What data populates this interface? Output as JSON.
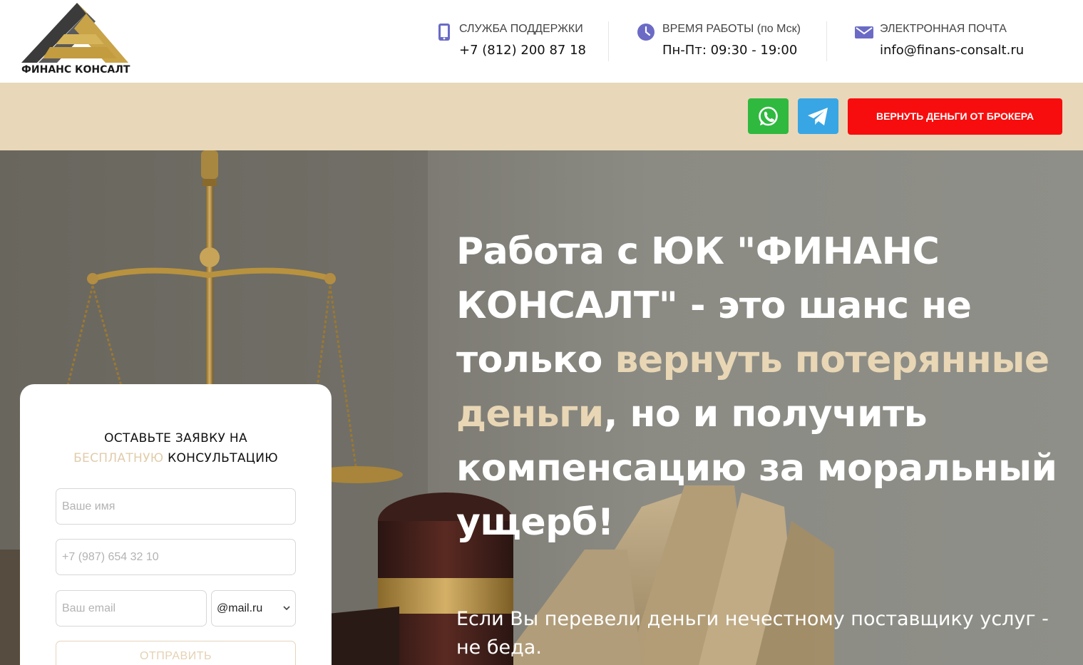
{
  "brand": {
    "logo_text": "ФИНАНС КОНСАЛТ"
  },
  "contacts": [
    {
      "label": "СЛУЖБА ПОДДЕРЖКИ",
      "value": "+7 (812) 200 87 18",
      "icon": "phone-icon"
    },
    {
      "label": "ВРЕМЯ РАБОТЫ (по Мск)",
      "value": "Пн-Пт: 09:30 - 19:00",
      "icon": "clock-icon"
    },
    {
      "label": "ЭЛЕКТРОННАЯ ПОЧТА",
      "value": "info@finans-consalt.ru",
      "icon": "mail-icon"
    }
  ],
  "actions": {
    "whatsapp_icon": "whatsapp-icon",
    "telegram_icon": "telegram-icon",
    "return_money_label": "ВЕРНУТЬ ДЕНЬГИ ОТ БРОКЕРА"
  },
  "hero": {
    "headline_part1": "Работа с ЮК \"ФИНАНС КОНСАЛТ\" - это шанс не только ",
    "headline_highlight": "вернуть потерянные деньги",
    "headline_part2": ", но и получить компенсацию за моральный ущерб!",
    "subtext": "Если Вы перевели деньги нечестному поставщику услуг - не беда."
  },
  "form": {
    "title_line1": "ОСТАВЬТЕ ЗАЯВКУ НА",
    "title_accent": "БЕСПЛАТНУЮ",
    "title_line2_rest": " КОНСУЛЬТАЦИЮ",
    "name_placeholder": "Ваше имя",
    "phone_placeholder": "+7 (987) 654 32 10",
    "email_placeholder": "Ваш email",
    "domain_selected": "@mail.ru",
    "submit_label": "ОТПРАВИТЬ"
  },
  "colors": {
    "beige_bar": "#e8d8b9",
    "accent_text": "#e8d6b5",
    "whatsapp": "#2fb93f",
    "telegram": "#38a6e4",
    "return_button": "#f70d0d",
    "contact_icons": "#6b6bc6"
  }
}
